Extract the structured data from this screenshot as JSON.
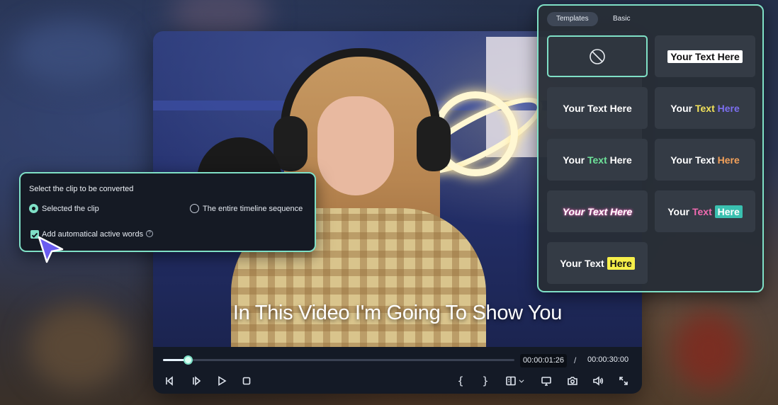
{
  "video": {
    "subtitle": "In This Video I'm Going To Show You",
    "progress": 0.07,
    "time_current": "00:00:01:26",
    "time_separator": "/",
    "time_total": "00:00:30:00"
  },
  "controls": [
    {
      "name": "prev-frame-icon"
    },
    {
      "name": "next-frame-icon"
    },
    {
      "name": "play-icon"
    },
    {
      "name": "stop-icon"
    },
    {
      "name": "mark-in-button",
      "label": "{"
    },
    {
      "name": "mark-out-button",
      "label": "}"
    },
    {
      "name": "split-view-icon"
    },
    {
      "name": "monitor-icon"
    },
    {
      "name": "snapshot-icon"
    },
    {
      "name": "volume-icon"
    },
    {
      "name": "fullscreen-icon"
    }
  ],
  "clip_dialog": {
    "title": "Select the clip to be converted",
    "option_selected_clip": "Selected the clip",
    "option_entire_timeline": "The entire timeline sequence",
    "selected_option": "Selected the clip",
    "checkbox_label": "Add automatical active words",
    "checkbox_checked": true,
    "help_glyph": "?"
  },
  "templates_panel": {
    "tabs": [
      {
        "label": "Templates",
        "active": true
      },
      {
        "label": "Basic",
        "active": false
      }
    ],
    "tiles": [
      {
        "type": "none",
        "selected": true
      },
      {
        "parts": [
          {
            "text": "Your Text Here",
            "color": "#111111",
            "bg": "#ffffff"
          }
        ]
      },
      {
        "parts": [
          {
            "text": "Your Text Here",
            "color": "#ffffff"
          }
        ]
      },
      {
        "parts": [
          {
            "text": "Your ",
            "color": "#ffffff"
          },
          {
            "text": "Text ",
            "color": "#f3e35b"
          },
          {
            "text": "Here",
            "color": "#7c6ff0"
          }
        ]
      },
      {
        "parts": [
          {
            "text": "Your ",
            "color": "#ffffff"
          },
          {
            "text": "Text ",
            "color": "#6ee39a"
          },
          {
            "text": "Here",
            "color": "#ffffff"
          }
        ]
      },
      {
        "parts": [
          {
            "text": "Your Text ",
            "color": "#ffffff"
          },
          {
            "text": "Here",
            "color": "#f5a25a"
          }
        ]
      },
      {
        "parts": [
          {
            "text": "Your Text Here",
            "color": "#ffffff",
            "italic": true,
            "glow": "#e05fb0"
          }
        ]
      },
      {
        "parts": [
          {
            "text": "Your ",
            "color": "#ffffff"
          },
          {
            "text": "Text ",
            "color": "#f06ab0"
          },
          {
            "text": "Here",
            "color": "#ffffff",
            "bg": "#3ac0b0"
          }
        ]
      },
      {
        "parts": [
          {
            "text": "Your Text ",
            "color": "#ffffff"
          },
          {
            "text": "Here",
            "color": "#111111",
            "bg": "#f6ef4a"
          }
        ]
      }
    ]
  },
  "colors": {
    "accent": "#7fe0c6",
    "panel_bg": "#282e36",
    "dialog_bg": "#151a24",
    "cursor": "#6a5cf0"
  }
}
